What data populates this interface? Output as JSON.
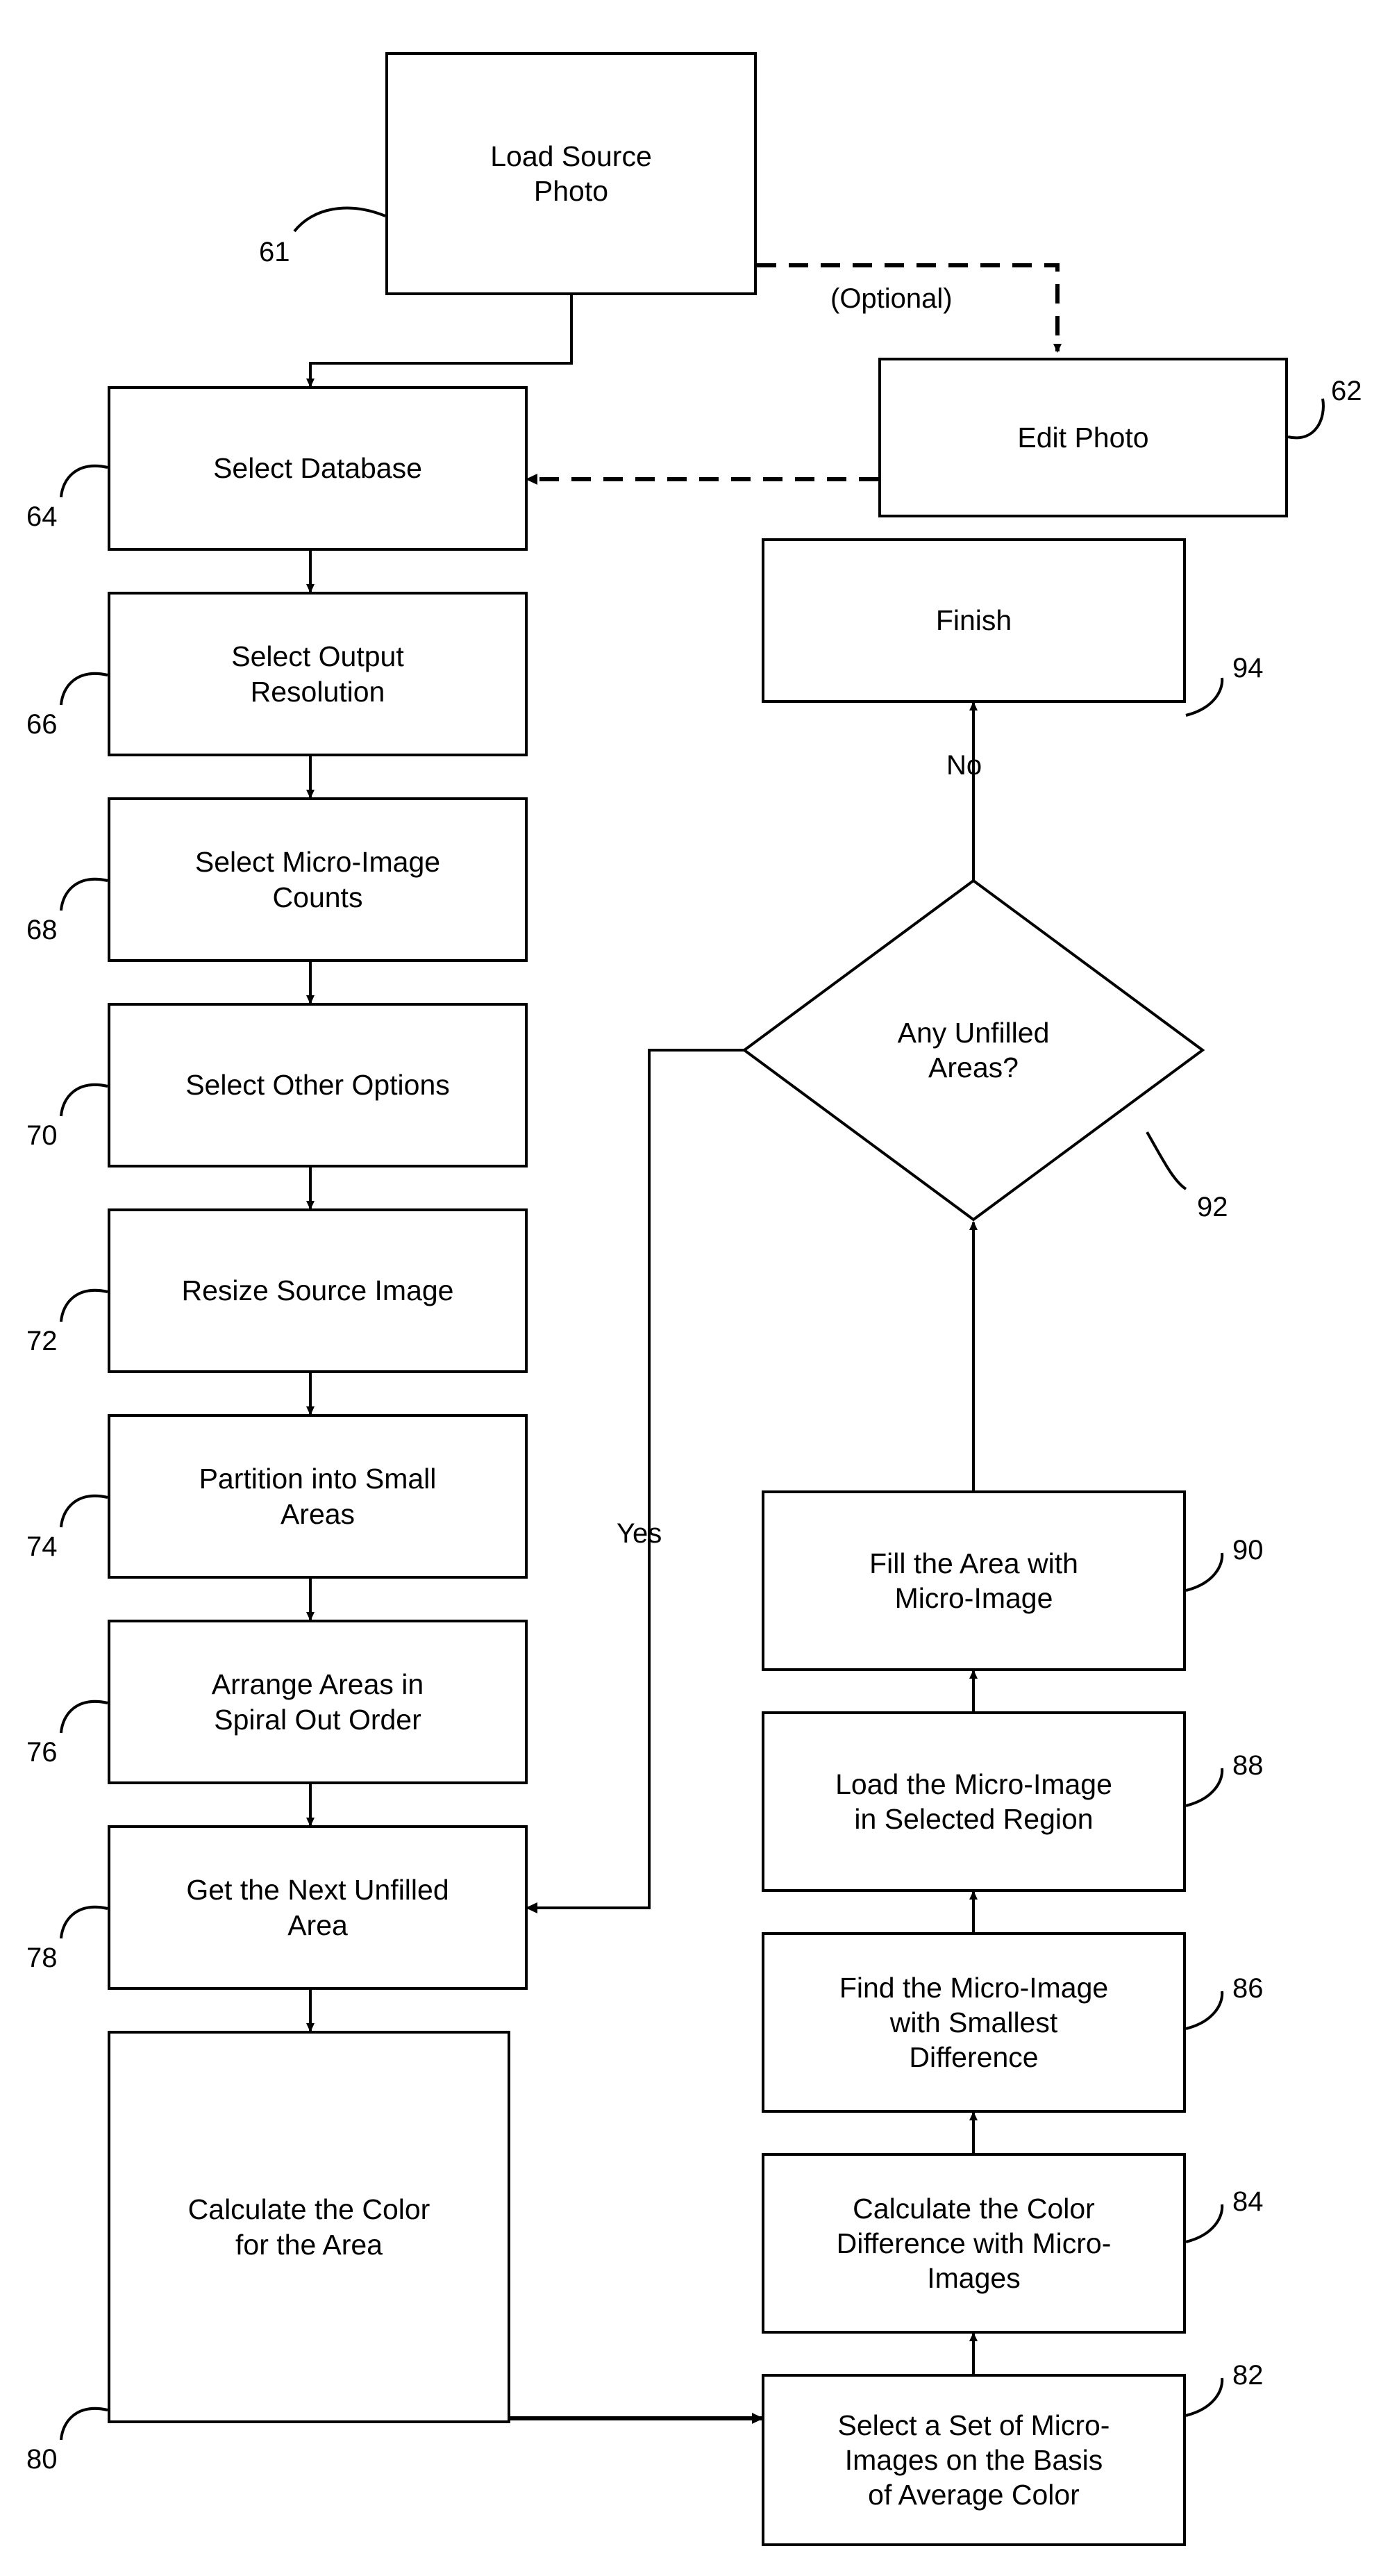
{
  "figure": {
    "type": "flowchart",
    "orientation": "two-column, top-to-bottom left column then bottom-to-top right column",
    "line_color": "#000000",
    "background_color": "#ffffff"
  },
  "nodes": [
    {
      "id": "n61",
      "ref": "61",
      "shape": "rect",
      "label": "Load Source\nPhoto"
    },
    {
      "id": "n62",
      "ref": "62",
      "shape": "rect",
      "label": "Edit Photo"
    },
    {
      "id": "n64",
      "ref": "64",
      "shape": "rect",
      "label": "Select Database"
    },
    {
      "id": "n66",
      "ref": "66",
      "shape": "rect",
      "label": "Select Output\nResolution"
    },
    {
      "id": "n68",
      "ref": "68",
      "shape": "rect",
      "label": "Select Micro-Image\nCounts"
    },
    {
      "id": "n70",
      "ref": "70",
      "shape": "rect",
      "label": "Select Other Options"
    },
    {
      "id": "n72",
      "ref": "72",
      "shape": "rect",
      "label": "Resize Source Image"
    },
    {
      "id": "n74",
      "ref": "74",
      "shape": "rect",
      "label": "Partition into Small\nAreas"
    },
    {
      "id": "n76",
      "ref": "76",
      "shape": "rect",
      "label": "Arrange Areas in\nSpiral Out Order"
    },
    {
      "id": "n78",
      "ref": "78",
      "shape": "rect",
      "label": "Get the Next Unfilled\nArea"
    },
    {
      "id": "n80",
      "ref": "80",
      "shape": "rect",
      "label": "Calculate the Color\nfor the Area"
    },
    {
      "id": "n82",
      "ref": "82",
      "shape": "rect",
      "label": "Select a Set of Micro-\nImages on the Basis\nof Average Color"
    },
    {
      "id": "n84",
      "ref": "84",
      "shape": "rect",
      "label": "Calculate the Color\nDifference with Micro-\nImages"
    },
    {
      "id": "n86",
      "ref": "86",
      "shape": "rect",
      "label": "Find the Micro-Image\nwith Smallest\nDifference"
    },
    {
      "id": "n88",
      "ref": "88",
      "shape": "rect",
      "label": "Load the Micro-Image\nin Selected Region"
    },
    {
      "id": "n90",
      "ref": "90",
      "shape": "rect",
      "label": "Fill the Area with\nMicro-Image"
    },
    {
      "id": "n92",
      "ref": "92",
      "shape": "diamond",
      "label": "Any Unfilled\nAreas?"
    },
    {
      "id": "n94",
      "ref": "94",
      "shape": "rect",
      "label": "Finish"
    }
  ],
  "edge_labels": {
    "optional": "(Optional)",
    "yes": "Yes",
    "no": "No"
  },
  "edges": [
    {
      "from": "n61",
      "to": "n64",
      "style": "solid",
      "label": ""
    },
    {
      "from": "n61",
      "to": "n62",
      "style": "dashed",
      "label": "(Optional)"
    },
    {
      "from": "n62",
      "to": "n64",
      "style": "dashed",
      "label": ""
    },
    {
      "from": "n64",
      "to": "n66",
      "style": "solid",
      "label": ""
    },
    {
      "from": "n66",
      "to": "n68",
      "style": "solid",
      "label": ""
    },
    {
      "from": "n68",
      "to": "n70",
      "style": "solid",
      "label": ""
    },
    {
      "from": "n70",
      "to": "n72",
      "style": "solid",
      "label": ""
    },
    {
      "from": "n72",
      "to": "n74",
      "style": "solid",
      "label": ""
    },
    {
      "from": "n74",
      "to": "n76",
      "style": "solid",
      "label": ""
    },
    {
      "from": "n76",
      "to": "n78",
      "style": "solid",
      "label": ""
    },
    {
      "from": "n78",
      "to": "n80",
      "style": "solid",
      "label": ""
    },
    {
      "from": "n80",
      "to": "n82",
      "style": "solid",
      "label": ""
    },
    {
      "from": "n82",
      "to": "n84",
      "style": "solid",
      "label": ""
    },
    {
      "from": "n84",
      "to": "n86",
      "style": "solid",
      "label": ""
    },
    {
      "from": "n86",
      "to": "n88",
      "style": "solid",
      "label": ""
    },
    {
      "from": "n88",
      "to": "n90",
      "style": "solid",
      "label": ""
    },
    {
      "from": "n90",
      "to": "n92",
      "style": "solid",
      "label": ""
    },
    {
      "from": "n92",
      "to": "n94",
      "style": "solid",
      "label": "No"
    },
    {
      "from": "n92",
      "to": "n78",
      "style": "solid",
      "label": "Yes"
    }
  ]
}
